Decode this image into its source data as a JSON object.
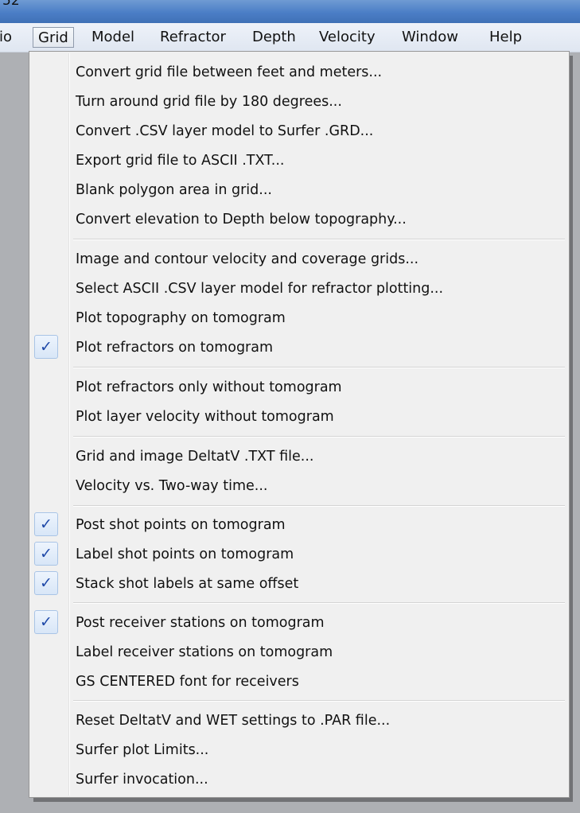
{
  "window": {
    "title_fragment": "52"
  },
  "menubar": {
    "items": [
      {
        "label": "io"
      },
      {
        "label": "Grid"
      },
      {
        "label": "Model"
      },
      {
        "label": "Refractor"
      },
      {
        "label": "Depth"
      },
      {
        "label": "Velocity"
      },
      {
        "label": "Window"
      },
      {
        "label": "Help"
      }
    ]
  },
  "grid_menu": {
    "items": [
      {
        "label": "Convert grid file between feet and meters...",
        "checked": false
      },
      {
        "label": "Turn around grid file by 180 degrees...",
        "checked": false
      },
      {
        "label": "Convert .CSV layer model to Surfer .GRD...",
        "checked": false
      },
      {
        "label": "Export grid file to ASCII .TXT...",
        "checked": false
      },
      {
        "label": "Blank polygon area in grid...",
        "checked": false
      },
      {
        "label": "Convert elevation to Depth below topography...",
        "checked": false
      },
      {
        "label": "Image and contour velocity and coverage grids...",
        "checked": false
      },
      {
        "label": "Select ASCII .CSV layer model for refractor plotting...",
        "checked": false
      },
      {
        "label": "Plot topography on tomogram",
        "checked": false
      },
      {
        "label": "Plot refractors on tomogram",
        "checked": true
      },
      {
        "label": "Plot refractors only without tomogram",
        "checked": false
      },
      {
        "label": "Plot layer velocity without tomogram",
        "checked": false
      },
      {
        "label": "Grid and image DeltatV .TXT file...",
        "checked": false
      },
      {
        "label": "Velocity vs. Two-way time...",
        "checked": false
      },
      {
        "label": "Post shot points on tomogram",
        "checked": true
      },
      {
        "label": "Label shot points on tomogram",
        "checked": true
      },
      {
        "label": "Stack shot labels at same offset",
        "checked": true
      },
      {
        "label": "Post receiver stations on tomogram",
        "checked": true
      },
      {
        "label": "Label receiver stations on tomogram",
        "checked": false
      },
      {
        "label": "GS CENTERED font for receivers",
        "checked": false
      },
      {
        "label": "Reset DeltatV and WET settings to .PAR file...",
        "checked": false
      },
      {
        "label": "Surfer plot Limits...",
        "checked": false
      },
      {
        "label": "Surfer invocation...",
        "checked": false
      }
    ],
    "check_glyph": "✓"
  },
  "colors": {
    "checkmark": "#1f49a8",
    "menu_background": "#f0f0f0",
    "desktop": "#aeb0b4"
  }
}
